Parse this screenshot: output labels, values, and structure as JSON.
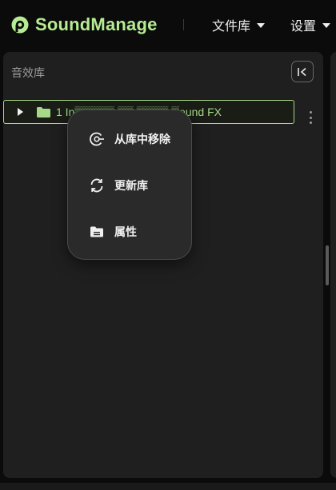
{
  "header": {
    "brand": "SoundManage",
    "nav": [
      {
        "label": "文件库"
      },
      {
        "label": "设置"
      }
    ]
  },
  "sidebar": {
    "title": "音效库",
    "tree": [
      {
        "label": "1 In▒▒▒▒▒ ▒▒ ▒▒▒▒ ▒ound FX",
        "expanded": false
      }
    ]
  },
  "context_menu": {
    "items": [
      {
        "label": "从库中移除",
        "icon": "remove-from-library-icon"
      },
      {
        "label": "更新库",
        "icon": "refresh-icon"
      },
      {
        "label": "属性",
        "icon": "folder-properties-icon"
      }
    ]
  },
  "colors": {
    "accent": "#b6ec93",
    "panel": "#1f1f1f",
    "menu": "#2a2a2a"
  }
}
